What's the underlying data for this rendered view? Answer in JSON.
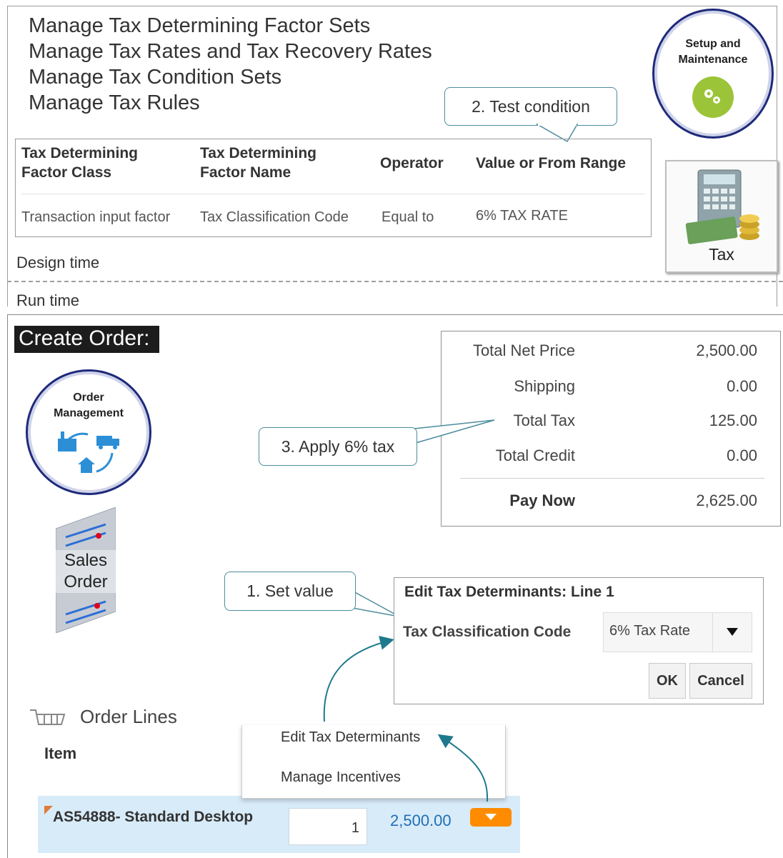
{
  "tasks": [
    "Manage Tax Determining Factor Sets",
    "Manage Tax Rates and Tax Recovery Rates",
    "Manage Tax Condition Sets",
    "Manage Tax Rules"
  ],
  "setup_button": {
    "line1": "Setup and",
    "line2": "Maintenance"
  },
  "tax_tile": {
    "label": "Tax"
  },
  "callouts": {
    "test_condition": "2. Test condition",
    "apply_tax": "3. Apply 6% tax",
    "set_value": "1. Set value"
  },
  "factor_table": {
    "headers": [
      [
        "Tax Determining",
        "Factor Class"
      ],
      [
        "Tax Determining",
        "Factor Name"
      ],
      [
        "Operator",
        ""
      ],
      [
        "Value or From Range",
        ""
      ]
    ],
    "row": [
      "Transaction input factor",
      "Tax Classification Code",
      "Equal to",
      "6% TAX RATE"
    ]
  },
  "design_time": "Design time",
  "run_time": "Run time",
  "create_order": "Create Order:",
  "order_mgmt": {
    "line1": "Order",
    "line2": "Management"
  },
  "sales_order": {
    "line1": "Sales",
    "line2": "Order"
  },
  "summary": [
    {
      "label": "Total Net Price",
      "value": "2,500.00"
    },
    {
      "label": "Shipping",
      "value": "0.00"
    },
    {
      "label": "Total Tax",
      "value": "125.00"
    },
    {
      "label": "Total Credit",
      "value": "0.00"
    }
  ],
  "pay_now": {
    "label": "Pay Now",
    "value": "2,625.00"
  },
  "dialog": {
    "title": "Edit Tax Determinants: Line 1",
    "field_label": "Tax Classification Code",
    "field_value": "6% Tax Rate",
    "ok": "OK",
    "cancel": "Cancel"
  },
  "order_lines": {
    "title": "Order Lines",
    "item_header": "Item"
  },
  "menu": [
    "Edit Tax Determinants",
    "Manage Incentives"
  ],
  "line": {
    "item": "AS54888- Standard Desktop",
    "qty": "1",
    "price": "2,500.00"
  },
  "colors": {
    "accent": "#ff8c00",
    "link": "#1f6fb5",
    "callout": "#4b8c9e",
    "circle": "#1e2a7a",
    "gear": "#9cc438"
  }
}
